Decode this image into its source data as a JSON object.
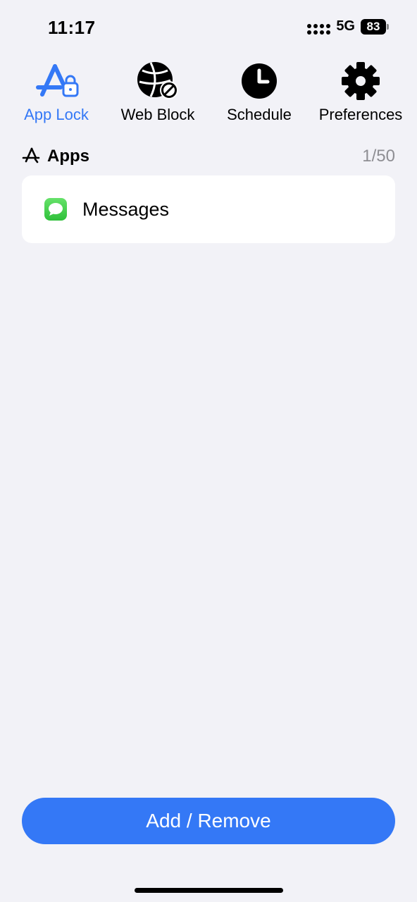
{
  "status_bar": {
    "time": "11:17",
    "network": "5G",
    "battery": "83"
  },
  "tabs": [
    {
      "label": "App Lock",
      "icon": "app-lock-icon",
      "active": true
    },
    {
      "label": "Web Block",
      "icon": "web-block-icon",
      "active": false
    },
    {
      "label": "Schedule",
      "icon": "clock-icon",
      "active": false
    },
    {
      "label": "Preferences",
      "icon": "gear-icon",
      "active": false
    }
  ],
  "section": {
    "title": "Apps",
    "count": "1/50"
  },
  "apps": [
    {
      "name": "Messages",
      "icon": "messages-icon"
    }
  ],
  "add_button": {
    "label": "Add / Remove"
  },
  "colors": {
    "accent": "#3478F6",
    "background": "#F2F2F7",
    "messages_green": "#34C759"
  }
}
